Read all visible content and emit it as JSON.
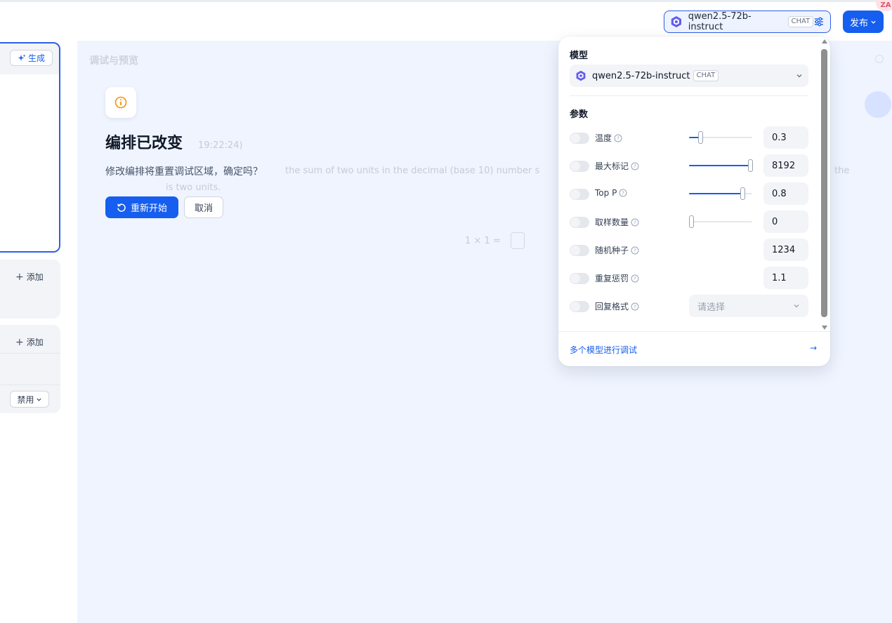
{
  "header": {
    "model_name": "qwen2.5-72b-instruct",
    "model_tag": "CHAT",
    "publish_label": "发布",
    "avatar_text": "ZA"
  },
  "left": {
    "generate_label": "生成",
    "add_label_1": "添加",
    "add_label_2": "添加",
    "disable_label": "禁用"
  },
  "background": {
    "panel_title": "调试与预览",
    "date_text": "19:22:24)",
    "line1": "the sum of two units in the decimal (base 10) number s",
    "line2": "is two units.",
    "line_right": "the",
    "pages": "1 × 1 ="
  },
  "dialog": {
    "title": "编排已改变",
    "message": "修改编排将重置调试区域，确定吗？",
    "confirm_label": "重新开始",
    "cancel_label": "取消"
  },
  "settings": {
    "model_section": "模型",
    "model_name": "qwen2.5-72b-instruct",
    "model_tag": "CHAT",
    "params_section": "参数",
    "params": [
      {
        "name": "温度",
        "value": "0.3",
        "slider": 0.18,
        "enabled": false
      },
      {
        "name": "最大标记",
        "value": "8192",
        "slider": 0.97,
        "enabled": false
      },
      {
        "name": "Top P",
        "value": "0.8",
        "slider": 0.84,
        "enabled": false
      },
      {
        "name": "取样数量",
        "value": "0",
        "slider": 0.03,
        "enabled": false
      },
      {
        "name": "随机种子",
        "value": "1234",
        "enabled": false
      },
      {
        "name": "重复惩罚",
        "value": "1.1",
        "enabled": false
      },
      {
        "name": "回复格式",
        "placeholder": "请选择",
        "enabled": false
      }
    ],
    "footer_label": "多个模型进行调试",
    "footer_arrow": "→"
  },
  "colors": {
    "accent": "#155eef",
    "panel_bg": "#eff4ff",
    "warning": "#f79009"
  }
}
